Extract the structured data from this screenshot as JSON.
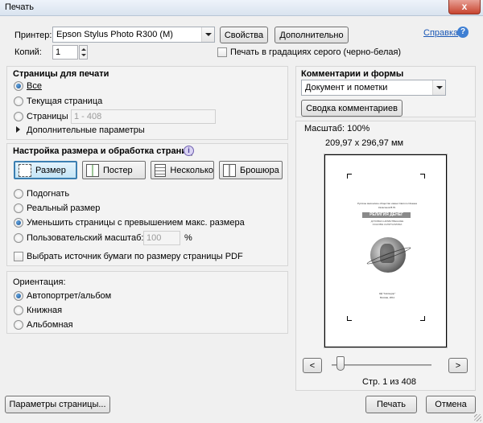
{
  "window": {
    "title": "Печать",
    "close_label": "x"
  },
  "printer": {
    "label": "Принтер:",
    "value": "Epson Stylus Photo R300 (M)",
    "properties_label": "Свойства",
    "advanced_label": "Дополнительно",
    "help_label": "Справка",
    "copies_label": "Копий:",
    "copies_value": "1",
    "grayscale_label": "Печать в градациях серого (черно-белая)"
  },
  "pages": {
    "title": "Страницы для печати",
    "all_label": "Все",
    "current_label": "Текущая страница",
    "pages_label": "Страницы",
    "pages_range_placeholder": "1 - 408",
    "more_options_label": "Дополнительные параметры"
  },
  "sizing": {
    "title": "Настройка размера и обработка страниц",
    "tabs": [
      "Размер",
      "Постер",
      "Несколько",
      "Брошюра"
    ],
    "fit_label": "Подогнать",
    "actual_label": "Реальный размер",
    "shrink_label": "Уменьшить страницы с превышением макс. размера",
    "custom_label": "Пользовательский масштаб:",
    "custom_value": "100",
    "percent": "%",
    "paper_source_label": "Выбрать источник бумаги по размеру страницы PDF"
  },
  "orientation": {
    "title": "Ориентация:",
    "auto_label": "Автопортрет/альбом",
    "portrait_label": "Книжная",
    "landscape_label": "Альбомная"
  },
  "comments": {
    "title": "Комментарии и формы",
    "value": "Документ и пометки",
    "summarize_label": "Сводка комментариев"
  },
  "preview": {
    "scale_label": "Масштаб: 100%",
    "size_label": "209,97 x 296,97 мм",
    "page_status": "Стр. 1 из 408",
    "prev_label": "<",
    "next_label": ">",
    "page_text": {
      "publisher_line": "Русское масонское общество имени Святого Иоанна",
      "author": "Катасонов В.Ю.",
      "title": "РЕЛИГИЯ ДЕНЕГ",
      "subtitle_1": "ДУХОВНО-НРАВСТВЕННЫЕ",
      "subtitle_2": "ОСНОВЫ КАПИТАЛИЗМА",
      "imprint_1": "НД \"Анкондор\"",
      "imprint_2": "Москва, 2011"
    }
  },
  "footer": {
    "page_setup_label": "Параметры страницы...",
    "print_label": "Печать",
    "cancel_label": "Отмена"
  }
}
